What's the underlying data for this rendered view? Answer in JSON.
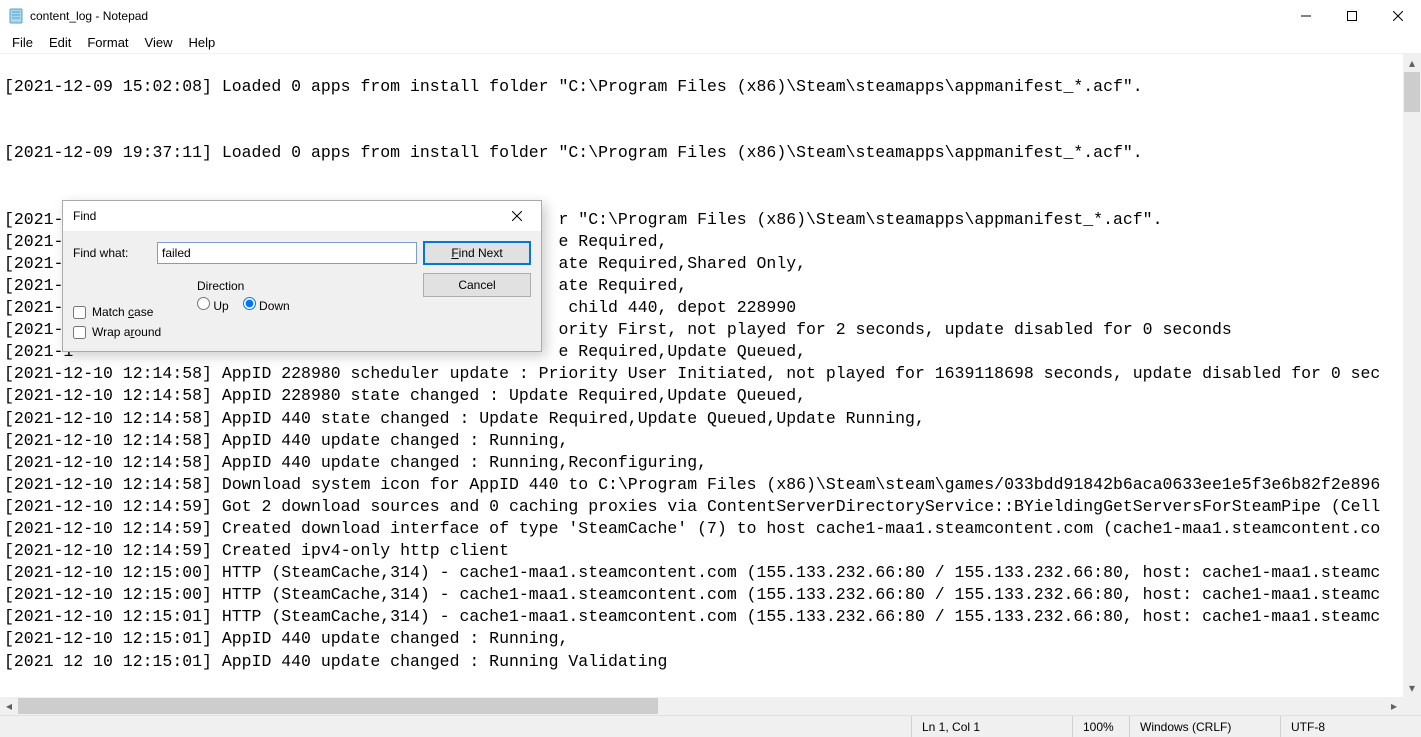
{
  "window": {
    "title": "content_log - Notepad"
  },
  "menu": {
    "file": "File",
    "edit": "Edit",
    "format": "Format",
    "view": "View",
    "help": "Help"
  },
  "editor": {
    "text": "\n[2021-12-09 15:02:08] Loaded 0 apps from install folder \"C:\\Program Files (x86)\\Steam\\steamapps\\appmanifest_*.acf\".\n\n\n[2021-12-09 19:37:11] Loaded 0 apps from install folder \"C:\\Program Files (x86)\\Steam\\steamapps\\appmanifest_*.acf\".\n\n\n[2021-1                                                 r \"C:\\Program Files (x86)\\Steam\\steamapps\\appmanifest_*.acf\".\n[2021-1                                                 e Required,\n[2021-1                                                 ate Required,Shared Only,\n[2021-1                                                 ate Required,\n[2021-1                                                  child 440, depot 228990\n[2021-1                                                 ority First, not played for 2 seconds, update disabled for 0 seconds\n[2021-1                                                 e Required,Update Queued,\n[2021-12-10 12:14:58] AppID 228980 scheduler update : Priority User Initiated, not played for 1639118698 seconds, update disabled for 0 sec\n[2021-12-10 12:14:58] AppID 228980 state changed : Update Required,Update Queued,\n[2021-12-10 12:14:58] AppID 440 state changed : Update Required,Update Queued,Update Running,\n[2021-12-10 12:14:58] AppID 440 update changed : Running,\n[2021-12-10 12:14:58] AppID 440 update changed : Running,Reconfiguring,\n[2021-12-10 12:14:58] Download system icon for AppID 440 to C:\\Program Files (x86)\\Steam\\steam\\games/033bdd91842b6aca0633ee1e5f3e6b82f2e896\n[2021-12-10 12:14:59] Got 2 download sources and 0 caching proxies via ContentServerDirectoryService::BYieldingGetServersForSteamPipe (Cell\n[2021-12-10 12:14:59] Created download interface of type 'SteamCache' (7) to host cache1-maa1.steamcontent.com (cache1-maa1.steamcontent.co\n[2021-12-10 12:14:59] Created ipv4-only http client\n[2021-12-10 12:15:00] HTTP (SteamCache,314) - cache1-maa1.steamcontent.com (155.133.232.66:80 / 155.133.232.66:80, host: cache1-maa1.steamc\n[2021-12-10 12:15:00] HTTP (SteamCache,314) - cache1-maa1.steamcontent.com (155.133.232.66:80 / 155.133.232.66:80, host: cache1-maa1.steamc\n[2021-12-10 12:15:01] HTTP (SteamCache,314) - cache1-maa1.steamcontent.com (155.133.232.66:80 / 155.133.232.66:80, host: cache1-maa1.steamc\n[2021-12-10 12:15:01] AppID 440 update changed : Running,\n[2021 12 10 12:15:01] AppID 440 update changed : Running Validating"
  },
  "find": {
    "title": "Find",
    "label": "Find what:",
    "value": "failed",
    "find_next": "Find Next",
    "cancel": "Cancel",
    "direction": "Direction",
    "up": "Up",
    "down": "Down",
    "match_case": "Match case",
    "wrap": "Wrap around"
  },
  "status": {
    "pos": "Ln 1, Col 1",
    "zoom": "100%",
    "eol": "Windows (CRLF)",
    "enc": "UTF-8"
  }
}
